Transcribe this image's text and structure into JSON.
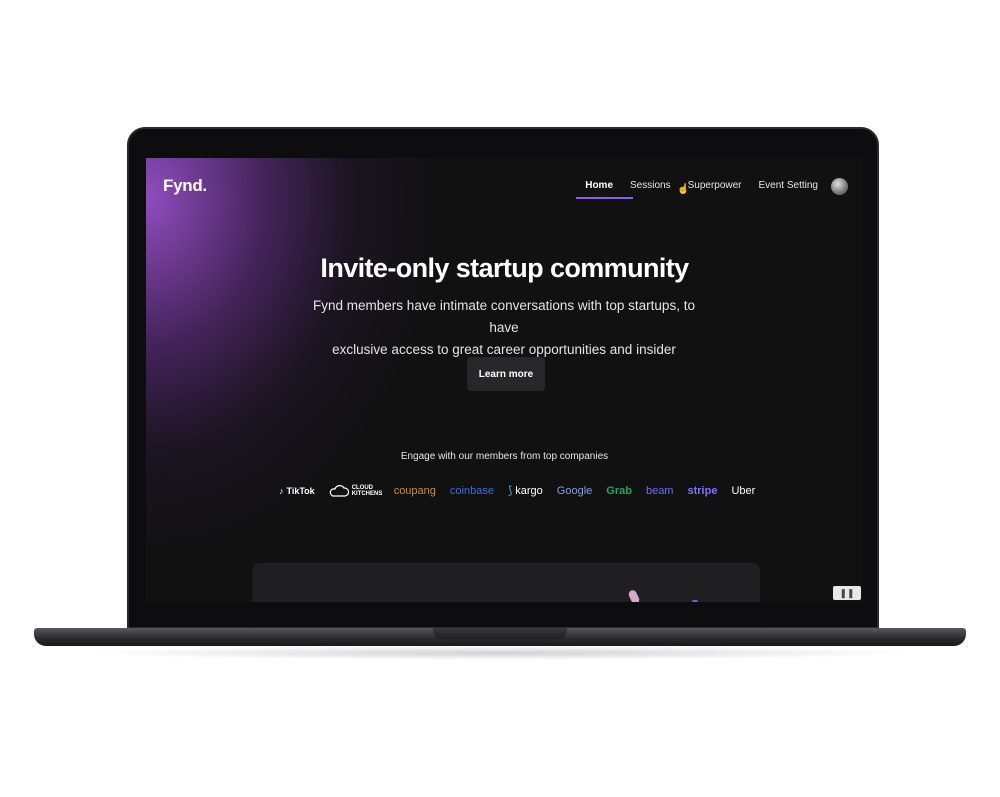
{
  "header": {
    "logo": "Fynd.",
    "nav": [
      {
        "label": "Home",
        "active": true
      },
      {
        "label": "Sessions",
        "active": false
      },
      {
        "label": "Superpower",
        "active": false
      },
      {
        "label": "Event Setting",
        "active": false
      }
    ]
  },
  "hero": {
    "title": "Invite-only startup community",
    "subtitle_line1": "Fynd members have intimate conversations with top startups, to have",
    "subtitle_line2": "exclusive access to great career opportunities and insider information",
    "cta_label": "Learn more"
  },
  "companies": {
    "heading": "Engage with our members from top companies",
    "logos": [
      "TikTok",
      "CLOUD KITCHENS",
      "coupang",
      "coinbase",
      "kargo",
      "Google",
      "Grab",
      "beam",
      "stripe",
      "Uber"
    ]
  },
  "colors": {
    "accent": "#8b5cf6",
    "background": "#111112",
    "glow": "#9650c8"
  }
}
